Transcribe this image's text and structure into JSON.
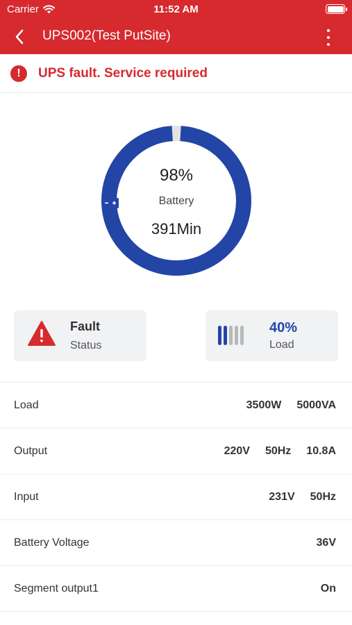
{
  "status_bar": {
    "carrier": "Carrier",
    "time": "11:52 AM"
  },
  "nav": {
    "title": "UPS002(Test PutSite)"
  },
  "alert": {
    "icon": "!",
    "text": "UPS fault. Service required"
  },
  "battery_ring": {
    "percent_label": "98%",
    "percent_value": 98,
    "label": "Battery",
    "runtime": "391Min"
  },
  "status_card": {
    "value": "Fault",
    "label": "Status"
  },
  "load_card": {
    "value": "40%",
    "label": "Load",
    "bars_total": 5,
    "bars_active": 2
  },
  "rows": [
    {
      "label": "Load",
      "values": [
        "3500W",
        "5000VA"
      ]
    },
    {
      "label": "Output",
      "values": [
        "220V",
        "50Hz",
        "10.8A"
      ]
    },
    {
      "label": "Input",
      "values": [
        "231V",
        "50Hz"
      ]
    },
    {
      "label": "Battery Voltage",
      "values": [
        "36V"
      ]
    },
    {
      "label": "Segment output1",
      "values": [
        "On"
      ]
    }
  ],
  "colors": {
    "brand": "#d62a2f",
    "accent": "#2345a6",
    "ring_track": "#e3e3e3",
    "bar_inactive": "#b8b8b8"
  }
}
